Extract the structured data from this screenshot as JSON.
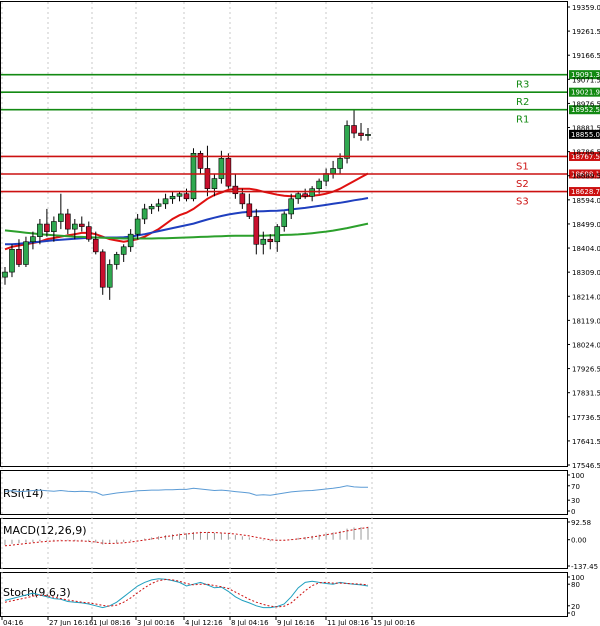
{
  "chart_data": {
    "type": "candlestick",
    "title": "",
    "price_axis": {
      "range": [
        17546.5,
        19359.0
      ],
      "ticks": [
        "19359.0",
        "19261.5",
        "19166.5",
        "19071.5",
        "18976.5",
        "18881.5",
        "18786.5",
        "18689.5",
        "18594.0",
        "18499.0",
        "18404.0",
        "18309.0",
        "18214.0",
        "18119.0",
        "18024.0",
        "17926.5",
        "17831.5",
        "17736.5",
        "17641.5",
        "17546.5"
      ]
    },
    "time_axis": {
      "labels": [
        "04:16",
        "27 Jun 16:16",
        "1 Jul 08:16",
        "3 Jul 00:16",
        "4 Jul 12:16",
        "8 Jul 04:16",
        "9 Jul 16:16",
        "11 Jul 08:16",
        "15 Jul 00:16"
      ]
    },
    "levels": [
      {
        "name": "R3",
        "value": 19091.3,
        "label": "19091.3",
        "color": "#138a13"
      },
      {
        "name": "R2",
        "value": 19021.9,
        "label": "19021.9",
        "color": "#138a13"
      },
      {
        "name": "R1",
        "value": 18952.5,
        "label": "18952.5",
        "color": "#138a13"
      },
      {
        "name": "S1",
        "value": 18767.5,
        "label": "18767.5",
        "color": "#cc1111"
      },
      {
        "name": "S2",
        "value": 18698.1,
        "label": "18698.1",
        "color": "#cc1111"
      },
      {
        "name": "S3",
        "value": 18628.7,
        "label": "18628.7",
        "color": "#cc1111"
      }
    ],
    "current_price": {
      "value": 18855.0,
      "label": "18855.0"
    },
    "candles": [
      {
        "o": 18290,
        "h": 18330,
        "l": 18260,
        "c": 18310
      },
      {
        "o": 18310,
        "h": 18420,
        "l": 18290,
        "c": 18400
      },
      {
        "o": 18400,
        "h": 18440,
        "l": 18330,
        "c": 18340
      },
      {
        "o": 18340,
        "h": 18450,
        "l": 18330,
        "c": 18430
      },
      {
        "o": 18430,
        "h": 18470,
        "l": 18400,
        "c": 18450
      },
      {
        "o": 18450,
        "h": 18520,
        "l": 18420,
        "c": 18500
      },
      {
        "o": 18500,
        "h": 18560,
        "l": 18450,
        "c": 18470
      },
      {
        "o": 18470,
        "h": 18530,
        "l": 18430,
        "c": 18510
      },
      {
        "o": 18510,
        "h": 18620,
        "l": 18480,
        "c": 18540
      },
      {
        "o": 18540,
        "h": 18560,
        "l": 18460,
        "c": 18480
      },
      {
        "o": 18480,
        "h": 18520,
        "l": 18440,
        "c": 18500
      },
      {
        "o": 18500,
        "h": 18530,
        "l": 18470,
        "c": 18490
      },
      {
        "o": 18490,
        "h": 18510,
        "l": 18430,
        "c": 18440
      },
      {
        "o": 18440,
        "h": 18470,
        "l": 18380,
        "c": 18390
      },
      {
        "o": 18390,
        "h": 18400,
        "l": 18220,
        "c": 18250
      },
      {
        "o": 18250,
        "h": 18360,
        "l": 18200,
        "c": 18340
      },
      {
        "o": 18340,
        "h": 18390,
        "l": 18320,
        "c": 18380
      },
      {
        "o": 18380,
        "h": 18420,
        "l": 18350,
        "c": 18410
      },
      {
        "o": 18410,
        "h": 18480,
        "l": 18390,
        "c": 18460
      },
      {
        "o": 18460,
        "h": 18540,
        "l": 18440,
        "c": 18520
      },
      {
        "o": 18520,
        "h": 18580,
        "l": 18500,
        "c": 18560
      },
      {
        "o": 18560,
        "h": 18580,
        "l": 18540,
        "c": 18570
      },
      {
        "o": 18570,
        "h": 18600,
        "l": 18550,
        "c": 18580
      },
      {
        "o": 18580,
        "h": 18620,
        "l": 18560,
        "c": 18600
      },
      {
        "o": 18600,
        "h": 18630,
        "l": 18580,
        "c": 18610
      },
      {
        "o": 18610,
        "h": 18630,
        "l": 18590,
        "c": 18620
      },
      {
        "o": 18620,
        "h": 18640,
        "l": 18590,
        "c": 18600
      },
      {
        "o": 18600,
        "h": 18800,
        "l": 18590,
        "c": 18780
      },
      {
        "o": 18780,
        "h": 18790,
        "l": 18700,
        "c": 18720
      },
      {
        "o": 18720,
        "h": 18810,
        "l": 18610,
        "c": 18640
      },
      {
        "o": 18640,
        "h": 18700,
        "l": 18610,
        "c": 18680
      },
      {
        "o": 18680,
        "h": 18790,
        "l": 18660,
        "c": 18760
      },
      {
        "o": 18760,
        "h": 18780,
        "l": 18640,
        "c": 18650
      },
      {
        "o": 18650,
        "h": 18700,
        "l": 18600,
        "c": 18620
      },
      {
        "o": 18620,
        "h": 18640,
        "l": 18560,
        "c": 18580
      },
      {
        "o": 18580,
        "h": 18620,
        "l": 18520,
        "c": 18530
      },
      {
        "o": 18530,
        "h": 18560,
        "l": 18380,
        "c": 18420
      },
      {
        "o": 18420,
        "h": 18470,
        "l": 18380,
        "c": 18440
      },
      {
        "o": 18440,
        "h": 18460,
        "l": 18400,
        "c": 18430
      },
      {
        "o": 18430,
        "h": 18500,
        "l": 18390,
        "c": 18490
      },
      {
        "o": 18490,
        "h": 18550,
        "l": 18470,
        "c": 18540
      },
      {
        "o": 18540,
        "h": 18620,
        "l": 18520,
        "c": 18600
      },
      {
        "o": 18600,
        "h": 18630,
        "l": 18580,
        "c": 18620
      },
      {
        "o": 18620,
        "h": 18640,
        "l": 18600,
        "c": 18610
      },
      {
        "o": 18610,
        "h": 18650,
        "l": 18590,
        "c": 18640
      },
      {
        "o": 18640,
        "h": 18680,
        "l": 18620,
        "c": 18670
      },
      {
        "o": 18670,
        "h": 18720,
        "l": 18650,
        "c": 18700
      },
      {
        "o": 18700,
        "h": 18750,
        "l": 18680,
        "c": 18720
      },
      {
        "o": 18720,
        "h": 18780,
        "l": 18700,
        "c": 18760
      },
      {
        "o": 18760,
        "h": 18910,
        "l": 18740,
        "c": 18890
      },
      {
        "o": 18890,
        "h": 18950,
        "l": 18840,
        "c": 18860
      },
      {
        "o": 18860,
        "h": 18900,
        "l": 18830,
        "c": 18850
      },
      {
        "o": 18850,
        "h": 18880,
        "l": 18830,
        "c": 18855
      }
    ],
    "moving_averages": [
      {
        "color": "#e01010",
        "values": [
          18400,
          18410,
          18415,
          18420,
          18425,
          18430,
          18440,
          18445,
          18450,
          18455,
          18460,
          18465,
          18465,
          18460,
          18450,
          18440,
          18435,
          18430,
          18435,
          18440,
          18450,
          18465,
          18480,
          18500,
          18520,
          18535,
          18545,
          18560,
          18580,
          18600,
          18615,
          18625,
          18635,
          18640,
          18640,
          18640,
          18635,
          18628,
          18622,
          18616,
          18612,
          18610,
          18610,
          18610,
          18612,
          18615,
          18620,
          18628,
          18640,
          18655,
          18670,
          18685,
          18700
        ]
      },
      {
        "color": "#1f3fbf",
        "values": [
          18420,
          18420,
          18422,
          18425,
          18428,
          18430,
          18433,
          18436,
          18438,
          18440,
          18442,
          18444,
          18446,
          18447,
          18447,
          18447,
          18447,
          18448,
          18450,
          18455,
          18460,
          18466,
          18472,
          18478,
          18484,
          18490,
          18496,
          18502,
          18510,
          18518,
          18525,
          18532,
          18538,
          18542,
          18546,
          18548,
          18550,
          18551,
          18552,
          18553,
          18555,
          18558,
          18561,
          18564,
          18568,
          18572,
          18576,
          18580,
          18584,
          18589,
          18594,
          18598,
          18603
        ]
      },
      {
        "color": "#2ca02c",
        "values": [
          18475,
          18472,
          18469,
          18466,
          18463,
          18460,
          18458,
          18456,
          18454,
          18452,
          18450,
          18449,
          18448,
          18447,
          18446,
          18445,
          18444,
          18443,
          18443,
          18443,
          18443,
          18443,
          18444,
          18444,
          18445,
          18446,
          18447,
          18448,
          18449,
          18450,
          18451,
          18452,
          18453,
          18454,
          18454,
          18454,
          18454,
          18454,
          18455,
          18456,
          18457,
          18458,
          18459,
          18461,
          18464,
          18467,
          18470,
          18474,
          18479,
          18484,
          18490,
          18496,
          18502
        ]
      }
    ],
    "indicators": {
      "rsi": {
        "label": "RSI(14)",
        "range": [
          0,
          100
        ],
        "ticks": [
          "100",
          "70",
          "30",
          "0"
        ],
        "tick_values": [
          100,
          70,
          30,
          0
        ],
        "color": "#5b9bd5",
        "values": [
          55,
          56,
          54,
          55,
          57,
          58,
          56,
          55,
          57,
          55,
          54,
          55,
          54,
          52,
          44,
          47,
          50,
          52,
          54,
          56,
          57,
          58,
          58,
          59,
          59,
          60,
          60,
          63,
          61,
          59,
          57,
          58,
          56,
          54,
          52,
          50,
          44,
          45,
          44,
          47,
          50,
          53,
          55,
          56,
          57,
          59,
          61,
          63,
          66,
          70,
          67,
          66,
          66
        ]
      },
      "macd": {
        "label": "MACD(12,26,9)",
        "range": [
          -137.45,
          92.58
        ],
        "ticks": [
          "92.58",
          "0.00",
          "-137.45"
        ],
        "tick_values": [
          92.58,
          0.0,
          -137.45
        ],
        "signal_color": "#cc1111",
        "histogram": [
          -28,
          -22,
          -18,
          -15,
          -12,
          -8,
          -5,
          -4,
          -2,
          -4,
          -6,
          -8,
          -10,
          -15,
          -25,
          -22,
          -18,
          -12,
          -6,
          0,
          6,
          12,
          18,
          24,
          28,
          32,
          34,
          40,
          42,
          40,
          36,
          34,
          30,
          24,
          18,
          12,
          2,
          -4,
          -8,
          -6,
          -2,
          4,
          10,
          14,
          20,
          26,
          32,
          38,
          46,
          58,
          64,
          66,
          68
        ],
        "signal": [
          -32,
          -28,
          -24,
          -20,
          -16,
          -12,
          -9,
          -7,
          -5,
          -5,
          -6,
          -7,
          -9,
          -12,
          -18,
          -20,
          -19,
          -16,
          -12,
          -7,
          -2,
          4,
          10,
          16,
          21,
          26,
          30,
          34,
          37,
          38,
          37,
          35,
          33,
          30,
          25,
          20,
          13,
          6,
          0,
          -3,
          -3,
          0,
          4,
          9,
          14,
          20,
          26,
          32,
          38,
          46,
          53,
          59,
          64
        ]
      },
      "stoch": {
        "label": "Stoch(9,6,3)",
        "range": [
          0,
          100
        ],
        "ticks": [
          "100",
          "80",
          "20",
          "0"
        ],
        "tick_values": [
          100,
          80,
          20,
          0
        ],
        "main_color": "#1f9fbf",
        "signal_color": "#cc1111",
        "main": [
          35,
          40,
          45,
          50,
          55,
          50,
          45,
          40,
          38,
          32,
          30,
          28,
          25,
          20,
          15,
          20,
          30,
          45,
          60,
          75,
          85,
          92,
          95,
          94,
          90,
          85,
          75,
          80,
          85,
          78,
          70,
          72,
          60,
          45,
          35,
          28,
          20,
          15,
          15,
          18,
          25,
          45,
          70,
          85,
          88,
          85,
          82,
          80,
          85,
          82,
          80,
          78,
          75
        ],
        "signal": [
          30,
          34,
          38,
          42,
          47,
          50,
          48,
          44,
          40,
          36,
          33,
          30,
          28,
          25,
          21,
          19,
          22,
          30,
          42,
          56,
          70,
          82,
          90,
          93,
          92,
          88,
          82,
          78,
          80,
          80,
          76,
          73,
          68,
          58,
          48,
          38,
          30,
          24,
          19,
          17,
          19,
          28,
          45,
          62,
          76,
          84,
          85,
          83,
          83,
          82,
          81,
          80,
          78
        ]
      }
    }
  }
}
